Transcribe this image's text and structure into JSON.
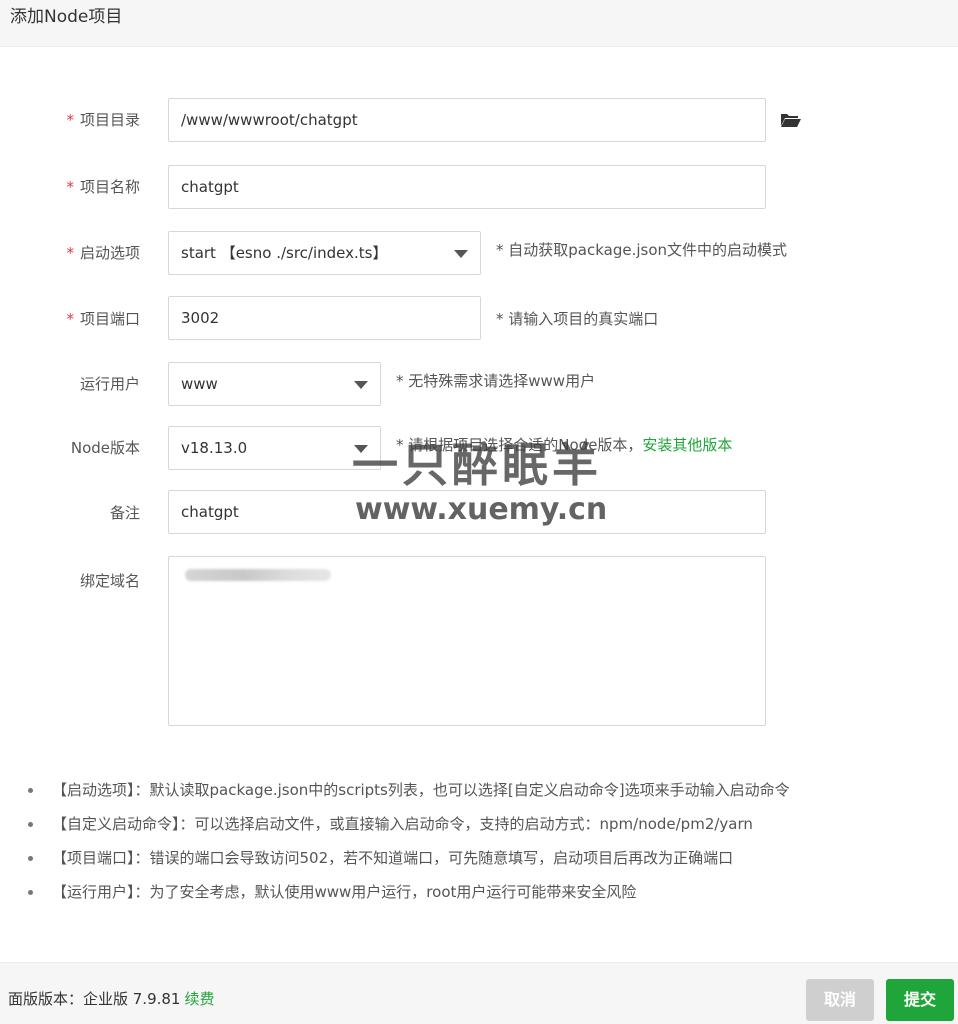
{
  "dialog": {
    "title": "添加Node项目"
  },
  "form": {
    "project_dir": {
      "label": "项目目录",
      "value": "/www/wwwroot/chatgpt",
      "required_mark": "*"
    },
    "project_name": {
      "label": "项目名称",
      "value": "chatgpt",
      "required_mark": "*"
    },
    "start_option": {
      "label": "启动选项",
      "value": "start 【esno ./src/index.ts】",
      "required_mark": "*",
      "hint": "* 自动获取package.json文件中的启动模式"
    },
    "project_port": {
      "label": "项目端口",
      "value": "3002",
      "required_mark": "*",
      "hint": "* 请输入项目的真实端口"
    },
    "run_user": {
      "label": "运行用户",
      "value": "www",
      "hint": "* 无特殊需求请选择www用户"
    },
    "node_version": {
      "label": "Node版本",
      "value": "v18.13.0",
      "hint": "* 请根据项目选择合适的Node版本，",
      "hint_link": "安装其他版本"
    },
    "remark": {
      "label": "备注",
      "value": "chatgpt"
    },
    "bind_domain": {
      "label": "绑定域名"
    }
  },
  "notes": [
    "【启动选项】：默认读取package.json中的scripts列表，也可以选择[自定义启动命令]选项来手动输入启动命令",
    "【自定义启动命令】：可以选择启动文件，或直接输入启动命令，支持的启动方式：npm/node/pm2/yarn",
    "【项目端口】：错误的端口会导致访问502，若不知道端口，可先随意填写，启动项目后再改为正确端口",
    "【运行用户】：为了安全考虑，默认使用www用户运行，root用户运行可能带来安全风险"
  ],
  "watermark": {
    "text_cn": "一只醉眠羊",
    "text_url": "www.xuemy.cn"
  },
  "footer": {
    "version_label": "面版版本：企业版 7.9.81",
    "renew_label": "续费",
    "cancel_label": "取消",
    "submit_label": "提交"
  },
  "colors": {
    "accent_green": "#20a53a",
    "required_red": "#e4393c",
    "cancel_gray": "#cfcfcf"
  },
  "icons": {
    "folder": "folder-open-icon",
    "select_arrow": "caret-down-icon"
  }
}
